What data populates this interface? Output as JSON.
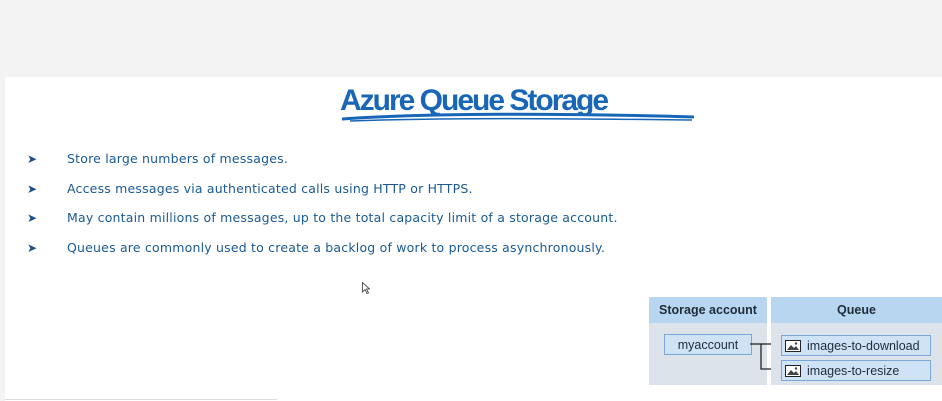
{
  "slide": {
    "title": "Azure Queue Storage",
    "bullets": [
      "Store large numbers of messages.",
      "Access messages via authenticated calls using HTTP or HTTPS.",
      "May contain millions of messages, up to the total capacity limit of a storage account.",
      "Queues are commonly used to create a backlog of work to process asynchronously."
    ],
    "diagram": {
      "storage_header": "Storage account",
      "queue_header": "Queue",
      "account_name": "myaccount",
      "queues": [
        "images-to-download",
        "images-to-resize"
      ]
    }
  },
  "colors": {
    "title": "#1866b8",
    "bullet_text": "#1a5a93",
    "header_fill": "#b9d6f0",
    "box_fill": "#cfe3f6"
  },
  "icons": {
    "bullet": "arrowhead-bullet-icon",
    "queue_item": "image-icon",
    "pointer": "mouse-cursor-icon"
  }
}
